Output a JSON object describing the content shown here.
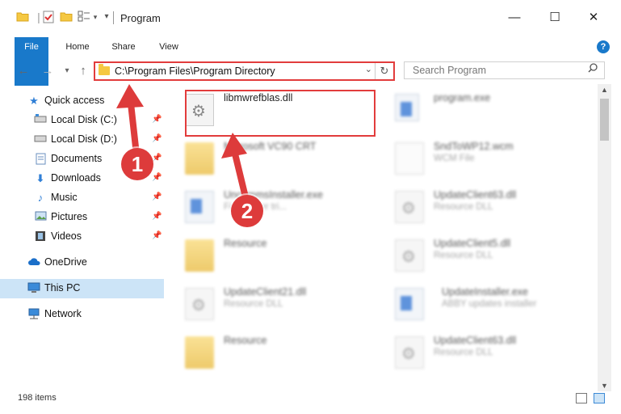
{
  "window": {
    "title": "Program"
  },
  "ribbon": {
    "tabs": [
      "File",
      "Home",
      "Share",
      "View"
    ],
    "help_label": "?"
  },
  "nav": {
    "address": "C:\\Program Files\\Program Directory",
    "search_placeholder": "Search Program"
  },
  "sidebar": {
    "items": [
      {
        "label": "Quick access"
      },
      {
        "label": "Local Disk (C:)"
      },
      {
        "label": "Local Disk (D:)"
      },
      {
        "label": "Documents"
      },
      {
        "label": "Downloads"
      },
      {
        "label": "Music"
      },
      {
        "label": "Pictures"
      },
      {
        "label": "Videos"
      },
      {
        "label": "OneDrive"
      },
      {
        "label": "This PC"
      },
      {
        "label": "Network"
      }
    ]
  },
  "files": [
    {
      "name": "libmwrefblas.dll",
      "sub": ""
    },
    {
      "name": "program.exe",
      "sub": ""
    },
    {
      "name": "Microsoft VC90 CRT",
      "sub": ""
    },
    {
      "name": "SndToWP12.wcm",
      "sub": "WCM File"
    },
    {
      "name": "UncommsInstaller.exe",
      "sub": "Finereader tri..."
    },
    {
      "name": "UpdateClient63.dll",
      "sub": "Resource DLL"
    },
    {
      "name": "Resource",
      "sub": ""
    },
    {
      "name": "UpdateClient5.dll",
      "sub": "Resource DLL"
    },
    {
      "name": "UpdateClient21.dll",
      "sub": "Resource DLL"
    },
    {
      "name": "UpdateInstaller.exe",
      "sub": "ABBY updates installer"
    },
    {
      "name": "Resource",
      "sub": ""
    },
    {
      "name": "UpdateClient63.dll",
      "sub": "Resource DLL"
    }
  ],
  "callouts": [
    "1",
    "2"
  ],
  "status": {
    "item_count": "198 items"
  },
  "colors": {
    "accent": "#1979ca",
    "highlight": "#e23c3c",
    "selected": "#cce4f7"
  }
}
